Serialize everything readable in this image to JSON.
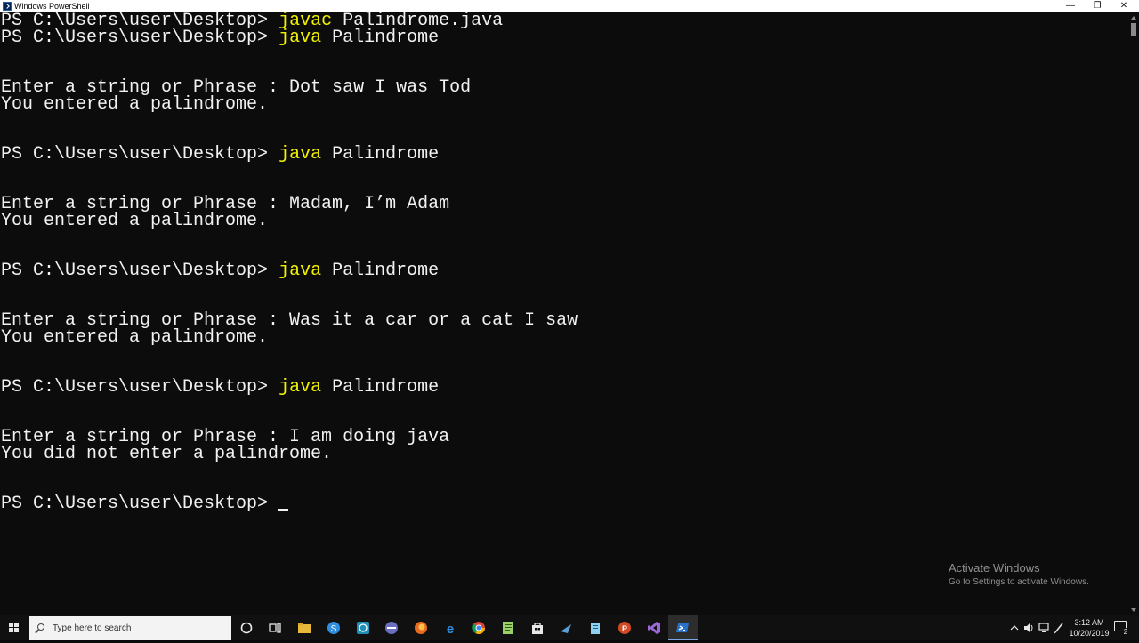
{
  "window": {
    "title": "Windows PowerShell",
    "minimize_glyph": "—",
    "restore_glyph": "❐",
    "close_glyph": "✕"
  },
  "console": {
    "prompt": "PS C:\\Users\\user\\Desktop> ",
    "lines": [
      {
        "kind": "command",
        "prompt": "PS C:\\Users\\user\\Desktop> ",
        "cmd": "javac",
        "args": " Palindrome.java"
      },
      {
        "kind": "command",
        "prompt": "PS C:\\Users\\user\\Desktop> ",
        "cmd": "java",
        "args": " Palindrome"
      },
      {
        "kind": "output",
        "text": "Enter a string or Phrase : Dot saw I was Tod"
      },
      {
        "kind": "output",
        "text": "You entered a palindrome."
      },
      {
        "kind": "command",
        "prompt": "PS C:\\Users\\user\\Desktop> ",
        "cmd": "java",
        "args": " Palindrome"
      },
      {
        "kind": "output",
        "text": "Enter a string or Phrase : Madam, I’m Adam"
      },
      {
        "kind": "output",
        "text": "You entered a palindrome."
      },
      {
        "kind": "command",
        "prompt": "PS C:\\Users\\user\\Desktop> ",
        "cmd": "java",
        "args": " Palindrome"
      },
      {
        "kind": "output",
        "text": "Enter a string or Phrase : Was it a car or a cat I saw"
      },
      {
        "kind": "output",
        "text": "You entered a palindrome."
      },
      {
        "kind": "command",
        "prompt": "PS C:\\Users\\user\\Desktop> ",
        "cmd": "java",
        "args": " Palindrome"
      },
      {
        "kind": "output",
        "text": "Enter a string or Phrase : I am doing java"
      },
      {
        "kind": "output",
        "text": "You did not enter a palindrome."
      },
      {
        "kind": "prompt",
        "prompt": "PS C:\\Users\\user\\Desktop> "
      }
    ],
    "colors": {
      "background": "#0c0c0c",
      "text": "#f2f2f2",
      "command": "#f2f200"
    }
  },
  "watermark": {
    "title": "Activate Windows",
    "subtitle": "Go to Settings to activate Windows."
  },
  "taskbar": {
    "search_placeholder": "Type here to search",
    "pinned_icons": [
      "cortana-icon",
      "task-view-icon",
      "file-explorer-icon",
      "skype-icon",
      "whatsapp-icon",
      "app-icon",
      "firefox-icon",
      "edge-icon",
      "chrome-icon",
      "notepadpp-icon",
      "store-icon",
      "app2-icon",
      "notepad-icon",
      "powerpoint-icon",
      "visual-studio-icon",
      "powershell-icon"
    ],
    "active_app": "powershell-icon",
    "clock_time": "3:12 AM",
    "clock_date": "10/20/2019",
    "notification_count": "2"
  }
}
